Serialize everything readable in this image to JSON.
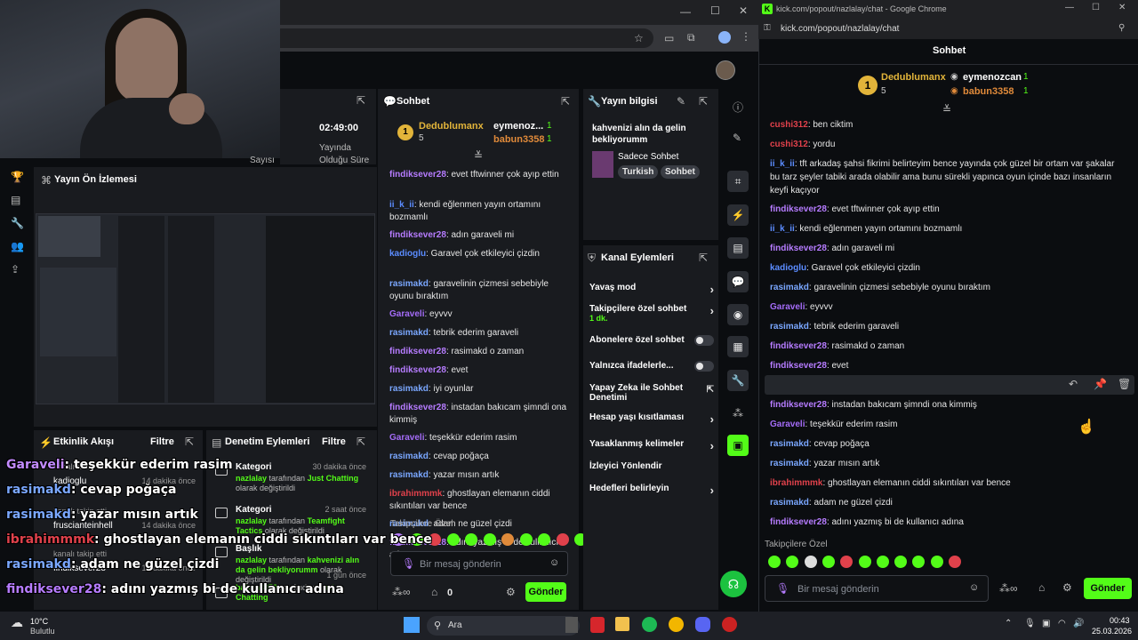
{
  "left_window": {
    "stats": {
      "duration": "02:49:00",
      "duration_label_1": "Yayında",
      "duration_label_2": "Olduğu Süre",
      "label_sayisi": "Sayısı"
    },
    "preview_title": "Yayın Ön İzlemesi",
    "activity": {
      "title": "Etkinlik Akışı",
      "filter": "Filtre",
      "items": [
        {
          "user": "kanalı takip etti",
          "time": ""
        },
        {
          "user": "kadioglu",
          "time": "14 dakika önce"
        },
        {
          "user": "kanalı takip etti",
          "time": ""
        },
        {
          "user": "fruscianteinhell",
          "time": "14 dakika önce"
        },
        {
          "user": "kanalı takip etti",
          "time": ""
        },
        {
          "user": "findiksever28",
          "time": "15 dakika önce"
        }
      ]
    },
    "moderation": {
      "title": "Denetim Eylemleri",
      "filter": "Filtre",
      "items": [
        {
          "type": "Kategori",
          "time": "30 dakika önce",
          "user": "nazlalay",
          "mid": " tarafından ",
          "value": "Just Chatting",
          "suffix": "olarak değiştirildi"
        },
        {
          "type": "Kategori",
          "time": "2 saat önce",
          "user": "nazlalay",
          "mid": " tarafından ",
          "value": "Teamfight Tactics",
          "suffix": "olarak değiştirildi"
        },
        {
          "type": "Başlık",
          "time": "",
          "user": "nazlalay",
          "mid": " tarafından ",
          "value": "kahvenizi alın da gelin bekliyorumm",
          "suffix": "olarak değiştirildi"
        },
        {
          "type": "",
          "time": "1 gün önce",
          "user": "babun3358",
          "mid": " tarafından ",
          "value": "Just Chatting",
          "suffix": ""
        }
      ]
    },
    "mid_chat": {
      "title": "Sohbet",
      "top1": {
        "name": "Dedublumanx",
        "count": "5"
      },
      "top2": {
        "name": "eymenoz...",
        "count": "1"
      },
      "top3": {
        "name": "babun3358",
        "count": "1"
      },
      "followers_only": "Takipçilere Özel",
      "placeholder": "Bir mesaj gönderin",
      "count": "0",
      "send": "Gönder",
      "messages": [
        {
          "user": "findiksever28",
          "text": ": evet tftwinner çok ayıp ettin",
          "color": "u-purple"
        },
        {
          "user": "ii_k_ii",
          "text": ": kendi eğlenmen yayın ortamını bozmamlı",
          "color": "u-blue"
        },
        {
          "user": "findiksever28",
          "text": ": adın garaveli mi",
          "color": "u-purple"
        },
        {
          "user": "kadioglu",
          "text": ": Garavel çok etkileyici çizdin",
          "color": "u-blue"
        },
        {
          "user": "rasimakd",
          "text": ": garavelinin çizmesi sebebiyle oyunu bıraktım",
          "color": "u-bluep"
        },
        {
          "user": "Garaveli",
          "text": ": eyvvv",
          "color": "u-lpurple"
        },
        {
          "user": "rasimakd",
          "text": ": tebrik ederim garaveli",
          "color": "u-bluep"
        },
        {
          "user": "findiksever28",
          "text": ": rasimakd o zaman",
          "color": "u-purple"
        },
        {
          "user": "findiksever28",
          "text": ": evet",
          "color": "u-purple"
        },
        {
          "user": "rasimakd",
          "text": ": iyi oyunlar",
          "color": "u-bluep"
        },
        {
          "user": "findiksever28",
          "text": ": instadan bakıcam şimndi ona kimmiş",
          "color": "u-purple"
        },
        {
          "user": "Garaveli",
          "text": ": teşekkür ederim rasim",
          "color": "u-lpurple"
        },
        {
          "user": "rasimakd",
          "text": ": cevap poğaça",
          "color": "u-bluep"
        },
        {
          "user": "rasimakd",
          "text": ": yazar mısın artık",
          "color": "u-bluep"
        },
        {
          "user": "ibrahimmmk",
          "text": ": ghostlayan elemanın ciddi sıkıntıları var bence",
          "color": "u-red"
        },
        {
          "user": "rasimakd",
          "text": ": adam ne güzel çizdi",
          "color": "u-bluep"
        },
        {
          "user": "findiksever28",
          "text": ": adını yazmış bi de kullanıcı adına",
          "color": "u-purple"
        }
      ]
    },
    "stream_info": {
      "title": "Yayın bilgisi",
      "stream_title": "kahvenizi alın da gelin bekliyorumm",
      "category": "Sadece Sohbet",
      "tags": [
        "Turkish",
        "Sohbet"
      ]
    },
    "channel_actions": {
      "title": "Kanal Eylemleri",
      "items": [
        {
          "label": "Yavaş mod",
          "sub": "",
          "control": "chevron"
        },
        {
          "label": "Takipçilere özel sohbet",
          "sub": "1 dk.",
          "control": "chevron"
        },
        {
          "label": "Abonelere özel sohbet",
          "sub": "",
          "control": "toggle"
        },
        {
          "label": "Yalnızca ifadelerle...",
          "sub": "",
          "control": "toggle"
        },
        {
          "label": "Yapay Zeka ile Sohbet Denetimi",
          "sub": "",
          "control": "external"
        },
        {
          "label": "Hesap yaşı kısıtlaması",
          "sub": "",
          "control": "chevron"
        },
        {
          "label": "Yasaklanmış kelimeler",
          "sub": "",
          "control": "chevron"
        },
        {
          "label": "İzleyici Yönlendir",
          "sub": "",
          "control": "none"
        },
        {
          "label": "Hedefleri belirleyin",
          "sub": "",
          "control": "chevron"
        }
      ]
    }
  },
  "overlay": [
    {
      "user": "Garaveli",
      "text": ": teşekkür ederim rasim",
      "color": "#c38bff"
    },
    {
      "user": "rasimakd",
      "text": ": cevap poğaça",
      "color": "#7aa7ff"
    },
    {
      "user": "rasimakd",
      "text": ": yazar mısın artık",
      "color": "#7aa7ff"
    },
    {
      "user": "ibrahimmmk",
      "text": ": ghostlayan elemanın ciddi sıkıntıları var bence",
      "color": "#e0414b"
    },
    {
      "user": "rasimakd",
      "text": ": adam ne güzel çizdi",
      "color": "#7aa7ff"
    },
    {
      "user": "findiksever28",
      "text": ": adını yazmış bi de kullanıcı adına",
      "color": "#b67cff"
    }
  ],
  "right_window": {
    "window_title": "kick.com/popout/nazlalay/chat - Google Chrome",
    "url": "kick.com/popout/nazlalay/chat",
    "header": "Sohbet",
    "top1": {
      "name": "Dedublumanx",
      "count": "5"
    },
    "top2": {
      "name": "eymenozcan",
      "count": "1"
    },
    "top3": {
      "name": "babun3358",
      "count": "1"
    },
    "followers_only": "Takipçilere Özel",
    "placeholder": "Bir mesaj gönderin",
    "send": "Gönder",
    "messages": [
      {
        "user": "cushi312",
        "text": ": ben ciktim",
        "color": "u-red"
      },
      {
        "user": "cushi312",
        "text": ": yordu",
        "color": "u-red"
      },
      {
        "user": "ii_k_ii",
        "text": ": tft arkadaş şahsi fikrimi belirteyim bence yayında çok güzel bir ortam var şakalar bu tarz şeyler tabiki arada olabilir ama bunu sürekli yapınca oyun içinde bazı insanların keyfi kaçıyor",
        "color": "u-blue"
      },
      {
        "user": "findiksever28",
        "text": ": evet tftwinner çok ayıp ettin",
        "color": "u-purple"
      },
      {
        "user": "ii_k_ii",
        "text": ": kendi eğlenmen yayın ortamını bozmamlı",
        "color": "u-blue"
      },
      {
        "user": "findiksever28",
        "text": ": adın garaveli mi",
        "color": "u-purple"
      },
      {
        "user": "kadioglu",
        "text": ": Garavel çok etkileyici çizdin",
        "color": "u-blue"
      },
      {
        "user": "rasimakd",
        "text": ": garavelinin çizmesi sebebiyle oyunu bıraktım",
        "color": "u-bluep"
      },
      {
        "user": "Garaveli",
        "text": ": eyvvv",
        "color": "u-lpurple"
      },
      {
        "user": "rasimakd",
        "text": ": tebrik ederim garaveli",
        "color": "u-bluep"
      },
      {
        "user": "findiksever28",
        "text": ": rasimakd o zaman",
        "color": "u-purple"
      },
      {
        "user": "findiksever28",
        "text": ": evet",
        "color": "u-purple"
      },
      {
        "user": "rasimakd",
        "text": ": iyi oyunlar",
        "color": "u-bluep"
      },
      {
        "user": "findiksever28",
        "text": ": instadan bakıcam şimndi ona kimmiş",
        "color": "u-purple"
      },
      {
        "user": "Garaveli",
        "text": ": teşekkür ederim rasim",
        "color": "u-lpurple"
      },
      {
        "user": "rasimakd",
        "text": ": cevap poğaça",
        "color": "u-bluep"
      },
      {
        "user": "rasimakd",
        "text": ": yazar mısın artık",
        "color": "u-bluep"
      },
      {
        "user": "ibrahimmmk",
        "text": ": ghostlayan elemanın ciddi sıkıntıları var bence",
        "color": "u-red"
      },
      {
        "user": "rasimakd",
        "text": ": adam ne güzel çizdi",
        "color": "u-bluep"
      },
      {
        "user": "findiksever28",
        "text": ": adını yazmış bi de kullanıcı adına",
        "color": "u-purple"
      }
    ]
  },
  "taskbar": {
    "weather_temp": "10°C",
    "weather_desc": "Bulutlu",
    "search": "Ara",
    "time": "00:43",
    "date": "25.03.2026"
  }
}
